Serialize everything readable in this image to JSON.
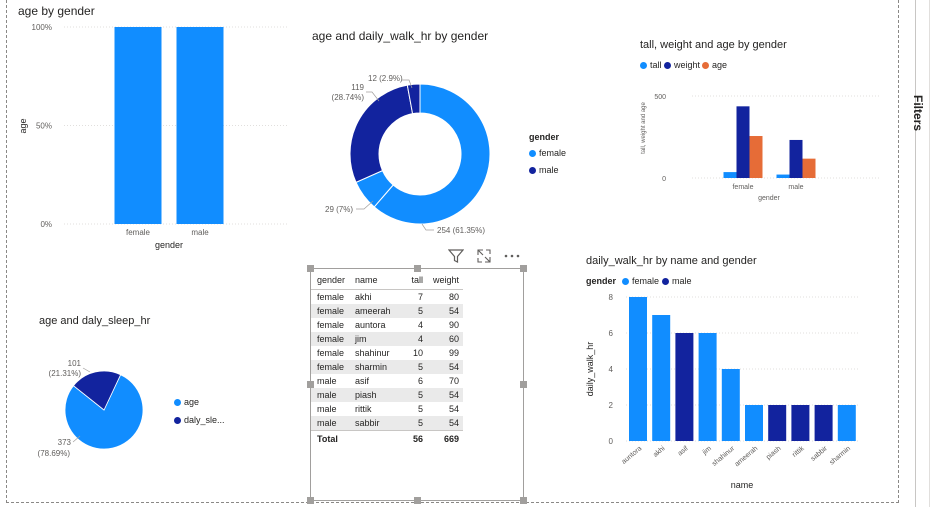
{
  "colors": {
    "light": "#118DFF",
    "dark": "#12239E",
    "orange": "#E66C37"
  },
  "sidebar": {
    "label": "Filters"
  },
  "visuals": {
    "age_by_gender": {
      "title": "age by gender",
      "ylabel": "age",
      "xlabel": "gender",
      "yticks": [
        "100%",
        "50%",
        "0%"
      ],
      "chart_data": {
        "type": "bar",
        "title": "age by gender",
        "xlabel": "gender",
        "ylabel": "age",
        "categories": [
          "female",
          "male"
        ],
        "values": [
          100,
          100
        ],
        "ylim": [
          0,
          100
        ]
      }
    },
    "age_walk_donut": {
      "title": "age and daily_walk_hr by gender",
      "legend_title": "gender",
      "legend": [
        "female",
        "male"
      ],
      "labels": {
        "a": "12 (2.9%)",
        "b1": "119",
        "b2": "(28.74%)",
        "c": "29 (7%)",
        "d": "254 (61.35%)"
      },
      "chart_data": {
        "type": "pie",
        "title": "age and daily_walk_hr by gender",
        "legend_title": "gender",
        "slices": [
          {
            "label": "254 (61.35%)",
            "value": 254,
            "color": "#118DFF"
          },
          {
            "label": "29 (7%)",
            "value": 29,
            "color": "#118DFF"
          },
          {
            "label": "119 (28.74%)",
            "value": 119,
            "color": "#12239E"
          },
          {
            "label": "12 (2.9%)",
            "value": 12,
            "color": "#12239E"
          }
        ]
      }
    },
    "tall_weight_age": {
      "title": "tall, weight and age by gender",
      "legend": [
        "tall",
        "weight",
        "age"
      ],
      "ylabel": "tall, weight and age",
      "xlabel": "gender",
      "yticks": [
        "500",
        "0"
      ],
      "chart_data": {
        "type": "bar",
        "title": "tall, weight and age by gender",
        "xlabel": "gender",
        "ylabel": "tall, weight and age",
        "categories": [
          "female",
          "male"
        ],
        "series": [
          {
            "name": "tall",
            "values": [
              36,
              21
            ]
          },
          {
            "name": "weight",
            "values": [
              437,
              232
            ]
          },
          {
            "name": "age",
            "values": [
              256,
              118
            ]
          }
        ],
        "ylim": [
          0,
          500
        ]
      }
    },
    "age_sleep_pie": {
      "title": "age and daly_sleep_hr",
      "legend": [
        "age",
        "daly_sle..."
      ],
      "labels": {
        "a1": "101",
        "a2": "(21.31%)",
        "b1": "373",
        "b2": "(78.69%)"
      },
      "chart_data": {
        "type": "pie",
        "title": "age and daly_sleep_hr",
        "slices": [
          {
            "label": "373 (78.69%)",
            "value": 373,
            "color": "#118DFF"
          },
          {
            "label": "101 (21.31%)",
            "value": 101,
            "color": "#12239E"
          }
        ]
      }
    },
    "table": {
      "headers": [
        "gender",
        "name",
        "tall",
        "weight"
      ],
      "rows": [
        [
          "female",
          "akhi",
          "7",
          "80"
        ],
        [
          "female",
          "ameerah",
          "5",
          "54"
        ],
        [
          "female",
          "auntora",
          "4",
          "90"
        ],
        [
          "female",
          "jim",
          "4",
          "60"
        ],
        [
          "female",
          "shahinur",
          "10",
          "99"
        ],
        [
          "female",
          "sharmin",
          "5",
          "54"
        ],
        [
          "male",
          "asif",
          "6",
          "70"
        ],
        [
          "male",
          "piash",
          "5",
          "54"
        ],
        [
          "male",
          "rittik",
          "5",
          "54"
        ],
        [
          "male",
          "sabbir",
          "5",
          "54"
        ]
      ],
      "total": [
        "Total",
        "",
        "56",
        "669"
      ]
    },
    "walk_by_name": {
      "title": "daily_walk_hr by name and gender",
      "legend_title": "gender",
      "legend": [
        "female",
        "male"
      ],
      "ylabel": "daily_walk_hr",
      "xlabel": "name",
      "yticks": [
        "8",
        "6",
        "4",
        "2",
        "0"
      ],
      "chart_data": {
        "type": "bar",
        "title": "daily_walk_hr by name and gender",
        "xlabel": "name",
        "ylabel": "daily_walk_hr",
        "ylim": [
          0,
          8
        ],
        "categories": [
          "auntora",
          "akhi",
          "asif",
          "jim",
          "shahinur",
          "ameerah",
          "piash",
          "rittik",
          "sabbir",
          "sharmin"
        ],
        "values": [
          8,
          7,
          6,
          6,
          4,
          2,
          2,
          2,
          2,
          2
        ],
        "gender": [
          "female",
          "female",
          "male",
          "female",
          "female",
          "female",
          "male",
          "male",
          "male",
          "female"
        ]
      }
    }
  }
}
